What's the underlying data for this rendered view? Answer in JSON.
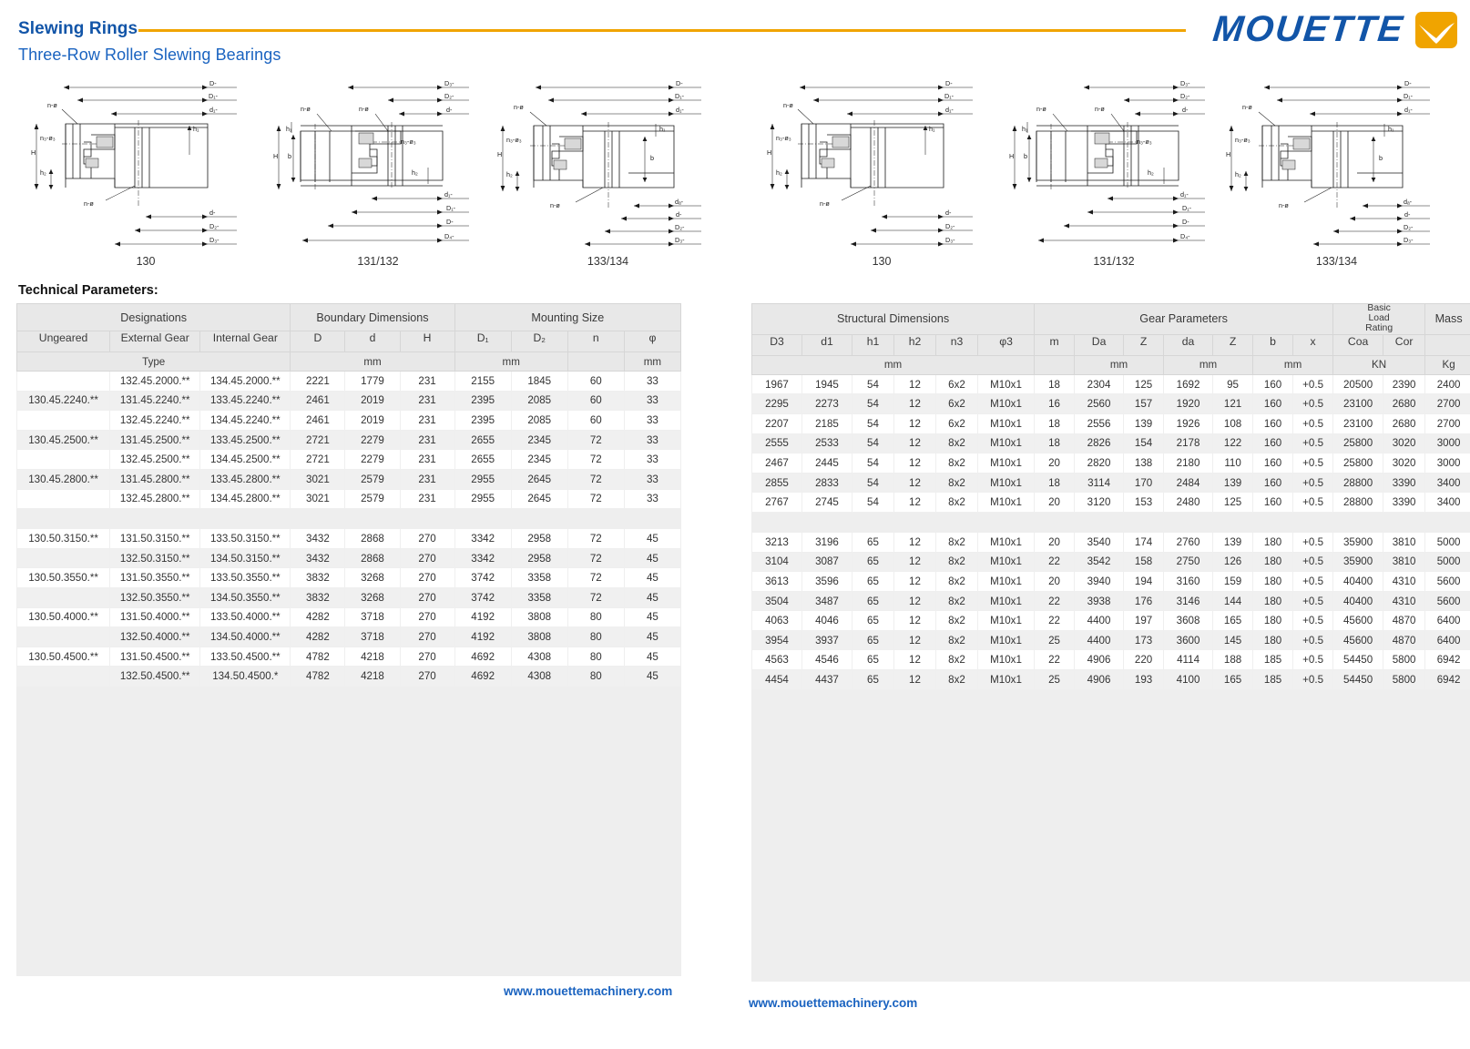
{
  "header": {
    "title": "Slewing Rings",
    "subtitle": "Three-Row Roller Slewing Bearings",
    "logo_text": "MOUETTE",
    "brand_blue": "#1255a8",
    "brand_orange": "#f0a400"
  },
  "section_label": "Technical Parameters:",
  "figures": {
    "captions": [
      "130",
      "131/132",
      "133/134",
      "130",
      "131/132",
      "133/134"
    ],
    "dimension_labels": [
      "D",
      "D1",
      "d1",
      "d",
      "D2",
      "D3",
      "D4",
      "da",
      "H",
      "h1",
      "h2",
      "b",
      "n-ø",
      "n3-ø3"
    ]
  },
  "left_table": {
    "group_headers": [
      {
        "label": "Designations",
        "span": 3
      },
      {
        "label": "Boundary Dimensions",
        "span": 3
      },
      {
        "label": "Mounting Size",
        "span": 4
      }
    ],
    "sub_headers": [
      "Ungeared",
      "External Gear",
      "Internal Gear",
      "D",
      "d",
      "H",
      "D₁",
      "D₂",
      "n",
      "φ"
    ],
    "unit_headers": [
      {
        "label": "Type",
        "span": 3
      },
      {
        "label": "mm",
        "span": 3
      },
      {
        "label": "mm",
        "span": 2
      },
      {
        "label": "",
        "span": 1
      },
      {
        "label": "mm",
        "span": 1
      }
    ],
    "rows": [
      [
        "",
        "132.45.2000.**",
        "134.45.2000.**",
        "2221",
        "1779",
        "231",
        "2155",
        "1845",
        "60",
        "33"
      ],
      [
        "130.45.2240.**",
        "131.45.2240.**",
        "133.45.2240.**",
        "2461",
        "2019",
        "231",
        "2395",
        "2085",
        "60",
        "33"
      ],
      [
        "",
        "132.45.2240.**",
        "134.45.2240.**",
        "2461",
        "2019",
        "231",
        "2395",
        "2085",
        "60",
        "33"
      ],
      [
        "130.45.2500.**",
        "131.45.2500.**",
        "133.45.2500.**",
        "2721",
        "2279",
        "231",
        "2655",
        "2345",
        "72",
        "33"
      ],
      [
        "",
        "132.45.2500.**",
        "134.45.2500.**",
        "2721",
        "2279",
        "231",
        "2655",
        "2345",
        "72",
        "33"
      ],
      [
        "130.45.2800.**",
        "131.45.2800.**",
        "133.45.2800.**",
        "3021",
        "2579",
        "231",
        "2955",
        "2645",
        "72",
        "33"
      ],
      [
        "",
        "132.45.2800.**",
        "134.45.2800.**",
        "3021",
        "2579",
        "231",
        "2955",
        "2645",
        "72",
        "33"
      ],
      [
        "SPACER"
      ],
      [
        "130.50.3150.**",
        "131.50.3150.**",
        "133.50.3150.**",
        "3432",
        "2868",
        "270",
        "3342",
        "2958",
        "72",
        "45"
      ],
      [
        "",
        "132.50.3150.**",
        "134.50.3150.**",
        "3432",
        "2868",
        "270",
        "3342",
        "2958",
        "72",
        "45"
      ],
      [
        "130.50.3550.**",
        "131.50.3550.**",
        "133.50.3550.**",
        "3832",
        "3268",
        "270",
        "3742",
        "3358",
        "72",
        "45"
      ],
      [
        "",
        "132.50.3550.**",
        "134.50.3550.**",
        "3832",
        "3268",
        "270",
        "3742",
        "3358",
        "72",
        "45"
      ],
      [
        "130.50.4000.**",
        "131.50.4000.**",
        "133.50.4000.**",
        "4282",
        "3718",
        "270",
        "4192",
        "3808",
        "80",
        "45"
      ],
      [
        "",
        "132.50.4000.**",
        "134.50.4000.**",
        "4282",
        "3718",
        "270",
        "4192",
        "3808",
        "80",
        "45"
      ],
      [
        "130.50.4500.**",
        "131.50.4500.**",
        "133.50.4500.**",
        "4782",
        "4218",
        "270",
        "4692",
        "4308",
        "80",
        "45"
      ],
      [
        "",
        "132.50.4500.**",
        "134.50.4500.*",
        "4782",
        "4218",
        "270",
        "4692",
        "4308",
        "80",
        "45"
      ]
    ]
  },
  "right_table": {
    "group_headers": [
      {
        "label": "Structural Dimensions",
        "span": 6
      },
      {
        "label": "Gear Parameters",
        "span": 7
      },
      {
        "label": "Basic Load Rating",
        "span": 2
      },
      {
        "label": "Mass",
        "span": 1
      }
    ],
    "sub_headers": [
      "D3",
      "d1",
      "h1",
      "h2",
      "n3",
      "φ3",
      "m",
      "Da",
      "Z",
      "da",
      "Z",
      "b",
      "x",
      "Coa",
      "Cor",
      ""
    ],
    "unit_headers": [
      {
        "label": "mm",
        "span": 6
      },
      {
        "label": "",
        "span": 1
      },
      {
        "label": "mm",
        "span": 2
      },
      {
        "label": "mm",
        "span": 2
      },
      {
        "label": "mm",
        "span": 2
      },
      {
        "label": "KN",
        "span": 2
      },
      {
        "label": "Kg",
        "span": 1
      }
    ],
    "rows": [
      [
        "1967",
        "1945",
        "54",
        "12",
        "6x2",
        "M10x1",
        "18",
        "2304",
        "125",
        "1692",
        "95",
        "160",
        "+0.5",
        "20500",
        "2390",
        "2400"
      ],
      [
        "2295",
        "2273",
        "54",
        "12",
        "6x2",
        "M10x1",
        "16",
        "2560",
        "157",
        "1920",
        "121",
        "160",
        "+0.5",
        "23100",
        "2680",
        "2700"
      ],
      [
        "2207",
        "2185",
        "54",
        "12",
        "6x2",
        "M10x1",
        "18",
        "2556",
        "139",
        "1926",
        "108",
        "160",
        "+0.5",
        "23100",
        "2680",
        "2700"
      ],
      [
        "2555",
        "2533",
        "54",
        "12",
        "8x2",
        "M10x1",
        "18",
        "2826",
        "154",
        "2178",
        "122",
        "160",
        "+0.5",
        "25800",
        "3020",
        "3000"
      ],
      [
        "2467",
        "2445",
        "54",
        "12",
        "8x2",
        "M10x1",
        "20",
        "2820",
        "138",
        "2180",
        "110",
        "160",
        "+0.5",
        "25800",
        "3020",
        "3000"
      ],
      [
        "2855",
        "2833",
        "54",
        "12",
        "8x2",
        "M10x1",
        "18",
        "3114",
        "170",
        "2484",
        "139",
        "160",
        "+0.5",
        "28800",
        "3390",
        "3400"
      ],
      [
        "2767",
        "2745",
        "54",
        "12",
        "8x2",
        "M10x1",
        "20",
        "3120",
        "153",
        "2480",
        "125",
        "160",
        "+0.5",
        "28800",
        "3390",
        "3400"
      ],
      [
        "SPACER"
      ],
      [
        "3213",
        "3196",
        "65",
        "12",
        "8x2",
        "M10x1",
        "20",
        "3540",
        "174",
        "2760",
        "139",
        "180",
        "+0.5",
        "35900",
        "3810",
        "5000"
      ],
      [
        "3104",
        "3087",
        "65",
        "12",
        "8x2",
        "M10x1",
        "22",
        "3542",
        "158",
        "2750",
        "126",
        "180",
        "+0.5",
        "35900",
        "3810",
        "5000"
      ],
      [
        "3613",
        "3596",
        "65",
        "12",
        "8x2",
        "M10x1",
        "20",
        "3940",
        "194",
        "3160",
        "159",
        "180",
        "+0.5",
        "40400",
        "4310",
        "5600"
      ],
      [
        "3504",
        "3487",
        "65",
        "12",
        "8x2",
        "M10x1",
        "22",
        "3938",
        "176",
        "3146",
        "144",
        "180",
        "+0.5",
        "40400",
        "4310",
        "5600"
      ],
      [
        "4063",
        "4046",
        "65",
        "12",
        "8x2",
        "M10x1",
        "22",
        "4400",
        "197",
        "3608",
        "165",
        "180",
        "+0.5",
        "45600",
        "4870",
        "6400"
      ],
      [
        "3954",
        "3937",
        "65",
        "12",
        "8x2",
        "M10x1",
        "25",
        "4400",
        "173",
        "3600",
        "145",
        "180",
        "+0.5",
        "45600",
        "4870",
        "6400"
      ],
      [
        "4563",
        "4546",
        "65",
        "12",
        "8x2",
        "M10x1",
        "22",
        "4906",
        "220",
        "4114",
        "188",
        "185",
        "+0.5",
        "54450",
        "5800",
        "6942"
      ],
      [
        "4454",
        "4437",
        "65",
        "12",
        "8x2",
        "M10x1",
        "25",
        "4906",
        "193",
        "4100",
        "165",
        "185",
        "+0.5",
        "54450",
        "5800",
        "6942"
      ]
    ]
  },
  "footer": {
    "left_url": "www.mouettemachinery.com",
    "right_url": "www.mouettemachinery.com"
  }
}
